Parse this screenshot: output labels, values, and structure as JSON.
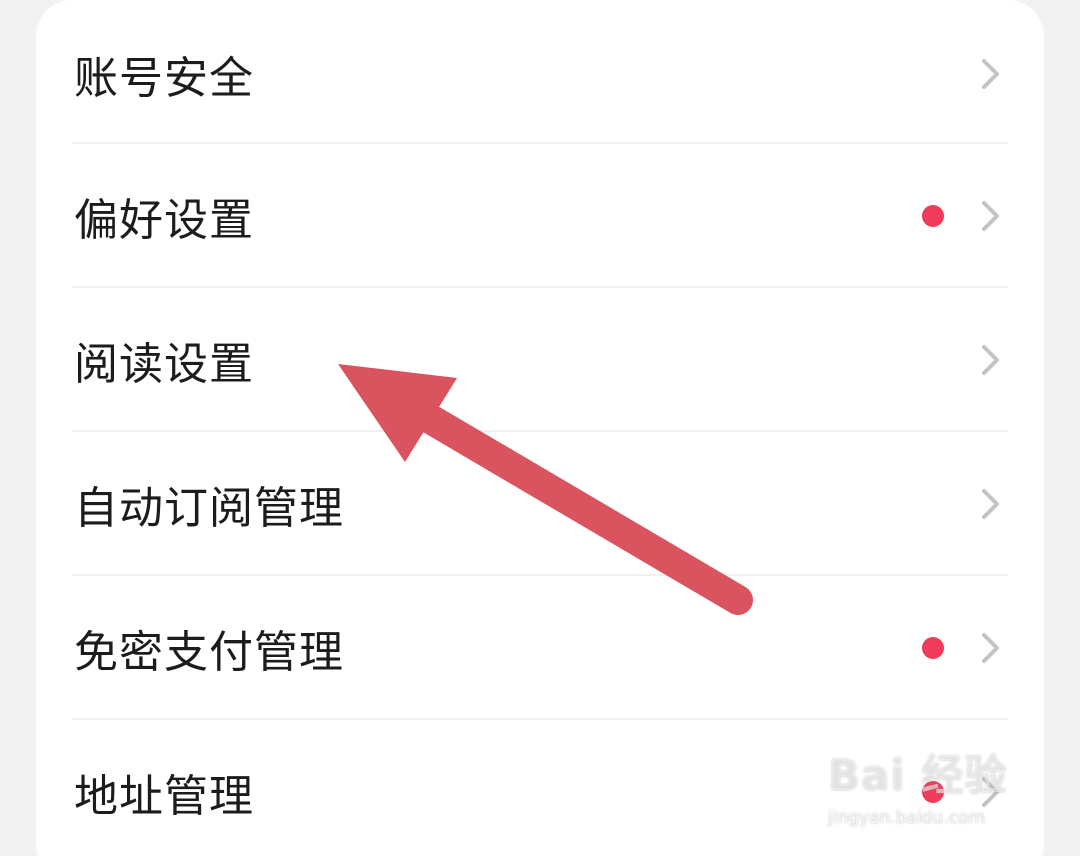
{
  "settings_list": {
    "items": [
      {
        "label": "账号安全",
        "has_dot": false
      },
      {
        "label": "偏好设置",
        "has_dot": true
      },
      {
        "label": "阅读设置",
        "has_dot": false
      },
      {
        "label": "自动订阅管理",
        "has_dot": false
      },
      {
        "label": "免密支付管理",
        "has_dot": true
      },
      {
        "label": "地址管理",
        "has_dot": true
      }
    ]
  },
  "icons": {
    "row_chevron": "chevron-right-icon",
    "notification_dot": "red-dot-icon",
    "annotation": "arrow-annotation"
  },
  "colors": {
    "background": "#f2f2f2",
    "card": "#ffffff",
    "text": "#1c1c1c",
    "chevron": "#c4c4c4",
    "dot": "#ef3c5a",
    "arrow": "#d9545e"
  },
  "watermark": {
    "brand": "Bai 经验",
    "url": "jingyan.baidu.com"
  }
}
